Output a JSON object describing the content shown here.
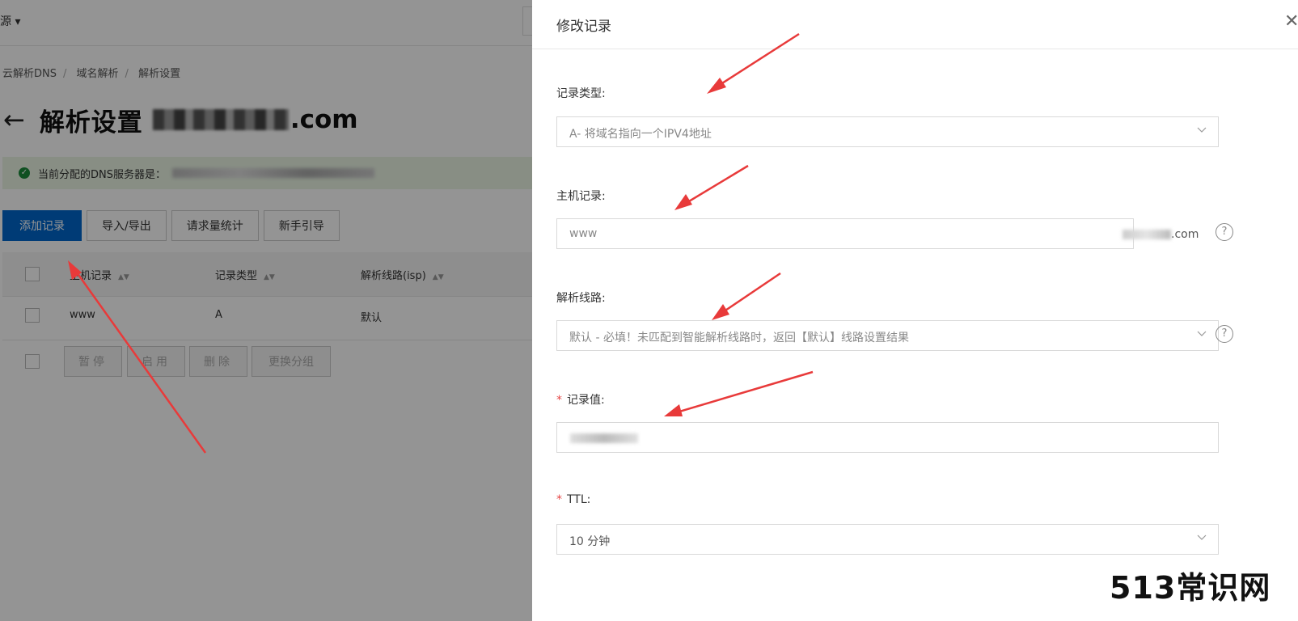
{
  "topbar": {
    "source_label": "源"
  },
  "breadcrumb": [
    "云解析DNS",
    "域名解析",
    "解析设置"
  ],
  "page": {
    "title": "解析设置",
    "domain_suffix": ".com"
  },
  "notice": {
    "text": "当前分配的DNS服务器是："
  },
  "toolbar": {
    "buttons": [
      "添加记录",
      "导入/导出",
      "请求量统计",
      "新手引导"
    ]
  },
  "table": {
    "columns": [
      "主机记录",
      "记录类型",
      "解析线路(isp)"
    ],
    "rows": [
      {
        "host": "www",
        "type": "A",
        "line": "默认"
      }
    ]
  },
  "bulk_actions": [
    "暂停",
    "启用",
    "删除",
    "更换分组"
  ],
  "drawer": {
    "title": "修改记录",
    "record_type": {
      "label": "记录类型:",
      "value": "A- 将域名指向一个IPV4地址"
    },
    "host": {
      "label": "主机记录:",
      "value": "www",
      "suffix": ".com"
    },
    "line": {
      "label": "解析线路:",
      "value": "默认 - 必填！未匹配到智能解析线路时，返回【默认】线路设置结果"
    },
    "record_value": {
      "label": "记录值:"
    },
    "ttl": {
      "label": "TTL:",
      "value": "10 分钟"
    }
  },
  "watermark": "513常识网",
  "colors": {
    "primary": "#0066cc",
    "arrow": "#e83a3a",
    "success": "#1a8a3a",
    "required": "#e64545"
  },
  "icons": [
    "back-arrow-icon",
    "check-circle-icon",
    "sort-icon",
    "close-icon",
    "chevron-down-icon",
    "help-icon"
  ]
}
